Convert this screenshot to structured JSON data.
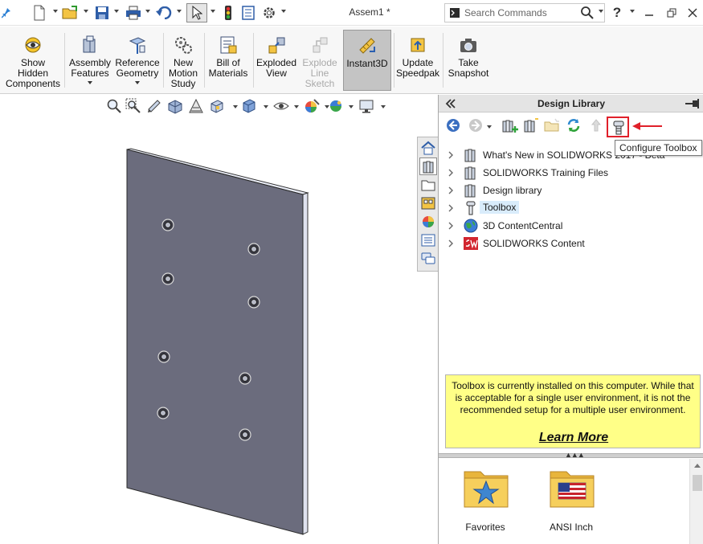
{
  "titlebar": {
    "document_title": "Assem1 *",
    "search_placeholder": "Search Commands",
    "help_label": "?"
  },
  "ribbon": {
    "buttons": [
      {
        "label": "Show Hidden Components",
        "lines": [
          "Show",
          "Hidden",
          "Components"
        ]
      },
      {
        "label": "Assembly Features",
        "lines": [
          "Assembly",
          "Features"
        ]
      },
      {
        "label": "Reference Geometry",
        "lines": [
          "Reference",
          "Geometry"
        ]
      },
      {
        "label": "New Motion Study",
        "lines": [
          "New",
          "Motion",
          "Study"
        ]
      },
      {
        "label": "Bill of Materials",
        "lines": [
          "Bill of",
          "Materials"
        ]
      },
      {
        "label": "Exploded View",
        "lines": [
          "Exploded",
          "View"
        ]
      },
      {
        "label": "Explode Line Sketch",
        "lines": [
          "Explode",
          "Line",
          "Sketch"
        ]
      },
      {
        "label": "Instant3D",
        "lines": [
          "Instant3D"
        ]
      },
      {
        "label": "Update Speedpak",
        "lines": [
          "Update",
          "Speedpak"
        ]
      },
      {
        "label": "Take Snapshot",
        "lines": [
          "Take",
          "Snapshot"
        ]
      }
    ]
  },
  "design_library": {
    "title": "Design Library",
    "tooltip": "Configure Toolbox",
    "tree": [
      {
        "label": "What's New in SOLIDWORKS 2017 - Beta",
        "icon": "library-books-icon"
      },
      {
        "label": "SOLIDWORKS Training Files",
        "icon": "library-books-icon"
      },
      {
        "label": "Design library",
        "icon": "library-books-icon"
      },
      {
        "label": "Toolbox",
        "icon": "toolbox-bolt-icon",
        "selected": true
      },
      {
        "label": "3D ContentCentral",
        "icon": "globe-icon"
      },
      {
        "label": "SOLIDWORKS Content",
        "icon": "solidworks-logo-icon"
      }
    ],
    "info": {
      "message": "Toolbox is currently installed on this computer. While that is acceptable for a single user environment, it is not the recommended setup for a multiple user environment.",
      "link": "Learn More"
    },
    "folders": [
      {
        "label": "Favorites",
        "icon": "favorites-folder-icon"
      },
      {
        "label": "ANSI Inch",
        "icon": "ansi-inch-folder-icon"
      }
    ]
  },
  "colors": {
    "accent_highlight": "#e0202a",
    "info_background": "#ffff87",
    "part_face": "#6b6c7d"
  }
}
